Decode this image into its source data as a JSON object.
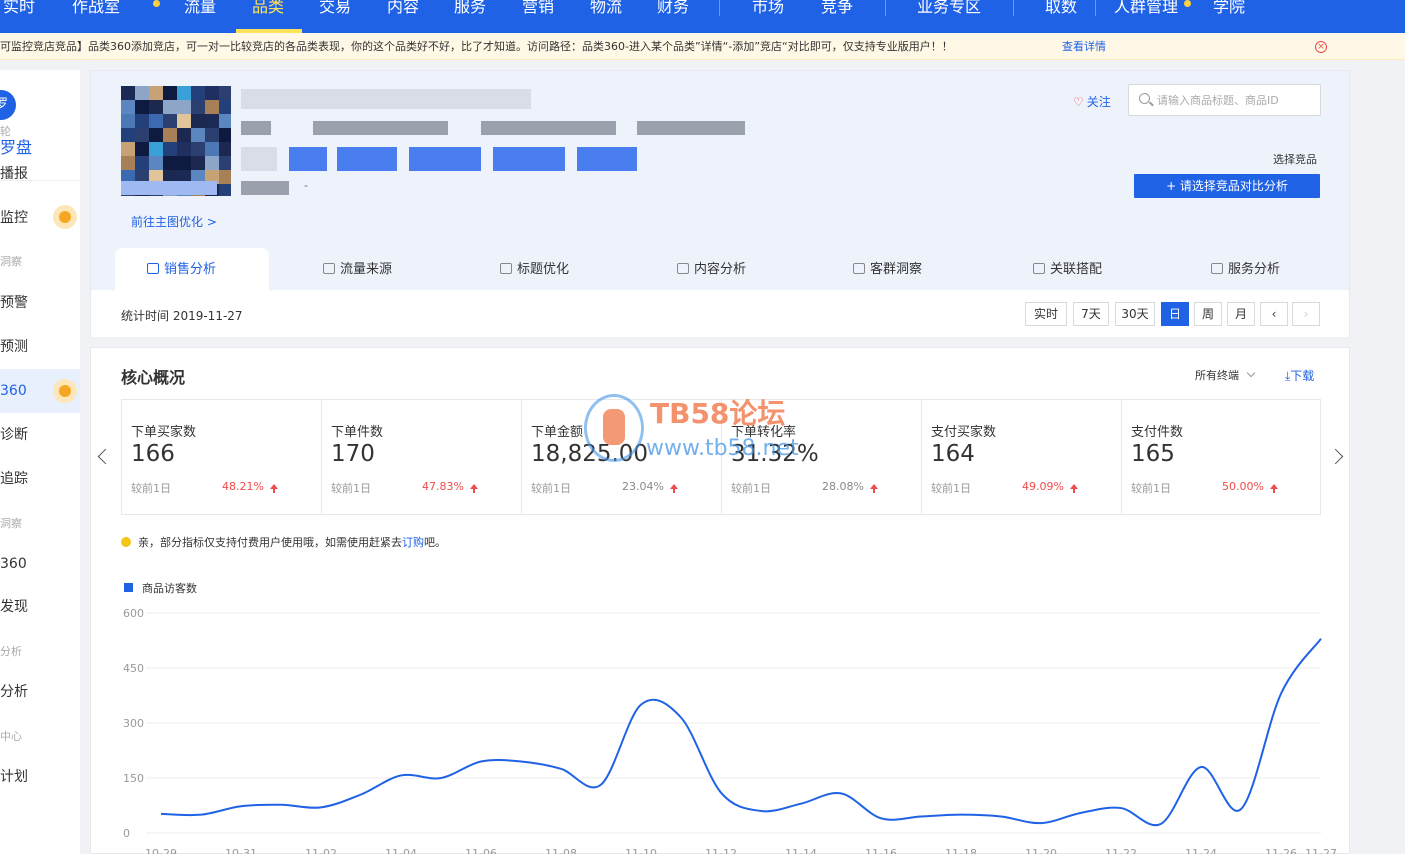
{
  "topnav": {
    "items": [
      {
        "label": "实时",
        "active": false
      },
      {
        "label": "作战室",
        "active": false
      },
      {
        "label": "流量",
        "active": false
      },
      {
        "label": "品类",
        "active": true
      },
      {
        "label": "交易",
        "active": false
      },
      {
        "label": "内容",
        "active": false
      },
      {
        "label": "服务",
        "active": false
      },
      {
        "label": "营销",
        "active": false
      },
      {
        "label": "物流",
        "active": false
      },
      {
        "label": "财务",
        "active": false
      },
      {
        "label": "市场",
        "active": false
      },
      {
        "label": "竞争",
        "active": false
      },
      {
        "label": "业务专区",
        "active": false
      },
      {
        "label": "取数",
        "active": false
      },
      {
        "label": "人群管理",
        "active": false
      },
      {
        "label": "学院",
        "active": false
      }
    ]
  },
  "notice": {
    "text": "可监控竞店竞品】品类360添加竞店，可一对一比较竞店的各品类表现，你的这个品类好不好，比了才知道。访问路径：品类360-进入某个品类”详情“-添加”竞店“对比即可，仅支持专业版用户！！",
    "link": "查看详情",
    "close": "×"
  },
  "sidebar": {
    "logo_glyph": "罗",
    "brand": "罗盘",
    "rows": [
      {
        "label": "轮",
        "type": "cat"
      },
      {
        "label": "播报",
        "type": "link"
      },
      {
        "label": "监控",
        "type": "link",
        "badge": true
      },
      {
        "label": "洞察",
        "type": "cat"
      },
      {
        "label": "预警",
        "type": "link"
      },
      {
        "label": "预测",
        "type": "link"
      },
      {
        "label": "360",
        "type": "link",
        "selected": true,
        "badge": true
      },
      {
        "label": "诊断",
        "type": "link"
      },
      {
        "label": "追踪",
        "type": "link"
      },
      {
        "label": "洞察",
        "type": "cat"
      },
      {
        "label": "360",
        "type": "link"
      },
      {
        "label": "发现",
        "type": "link"
      },
      {
        "label": "分析",
        "type": "cat"
      },
      {
        "label": "分析",
        "type": "link"
      },
      {
        "label": "中心",
        "type": "cat"
      },
      {
        "label": "计划",
        "type": "link"
      }
    ]
  },
  "product": {
    "dash": "-",
    "goto": "前往主图优化 >",
    "follow": "关注",
    "search_placeholder": "请输入商品标题、商品ID",
    "select_label": "选择竞品",
    "compare_button": "+ 请选择竞品对比分析"
  },
  "tabs": [
    {
      "label": "销售分析",
      "active": true
    },
    {
      "label": "流量来源"
    },
    {
      "label": "标题优化"
    },
    {
      "label": "内容分析"
    },
    {
      "label": "客群洞察"
    },
    {
      "label": "关联搭配"
    },
    {
      "label": "服务分析"
    }
  ],
  "timebar": {
    "stat_time": "统计时间 2019-11-27",
    "buttons": [
      {
        "label": "实时"
      },
      {
        "label": "7天"
      },
      {
        "label": "30天"
      },
      {
        "label": "日",
        "active": true
      },
      {
        "label": "周"
      },
      {
        "label": "月"
      },
      {
        "label": "‹"
      },
      {
        "label": "›",
        "disabled": true
      }
    ]
  },
  "core": {
    "title": "核心概况",
    "terminal": "所有终端",
    "download": "⤓下载",
    "metrics": [
      {
        "label": "下单买家数",
        "value": "166",
        "compare": "较前1日",
        "pct": "48.21%",
        "color": "red"
      },
      {
        "label": "下单件数",
        "value": "170",
        "compare": "较前1日",
        "pct": "47.83%",
        "color": "red"
      },
      {
        "label": "下单金额",
        "value": "18,825.00",
        "compare": "较前1日",
        "pct": "23.04%",
        "color": "grey"
      },
      {
        "label": "下单转化率",
        "value": "31.32%",
        "compare": "较前1日",
        "pct": "28.08%",
        "color": "grey"
      },
      {
        "label": "支付买家数",
        "value": "164",
        "compare": "较前1日",
        "pct": "49.09%",
        "color": "red"
      },
      {
        "label": "支付件数",
        "value": "165",
        "compare": "较前1日",
        "pct": "50.00%",
        "color": "red"
      }
    ],
    "tip": {
      "before": "亲，部分指标仅支持付费用户使用哦，如需使用赶紧去",
      "link": "订购",
      "after": "吧。"
    }
  },
  "watermark": {
    "line1": "TB58论坛",
    "line2": "www.tb58.net"
  },
  "chart_data": {
    "type": "line",
    "series": [
      {
        "name": "商品访客数",
        "color": "#2062e6",
        "values": [
          52,
          50,
          73,
          77,
          70,
          105,
          157,
          150,
          195,
          195,
          175,
          132,
          350,
          315,
          110,
          60,
          80,
          108,
          40,
          45,
          50,
          45,
          27,
          55,
          68,
          25,
          180,
          65,
          380,
          530
        ]
      }
    ],
    "x": [
      "10-29",
      "10-30",
      "10-31",
      "11-01",
      "11-02",
      "11-03",
      "11-04",
      "11-05",
      "11-06",
      "11-07",
      "11-08",
      "11-09",
      "11-10",
      "11-11",
      "11-12",
      "11-13",
      "11-14",
      "11-15",
      "11-16",
      "11-17",
      "11-18",
      "11-19",
      "11-20",
      "11-21",
      "11-22",
      "11-23",
      "11-24",
      "11-25",
      "11-26",
      "11-27"
    ],
    "yticks": [
      600,
      450,
      300,
      150,
      0
    ],
    "ylim": [
      0,
      600
    ],
    "grid": true,
    "legend": "top-left"
  }
}
